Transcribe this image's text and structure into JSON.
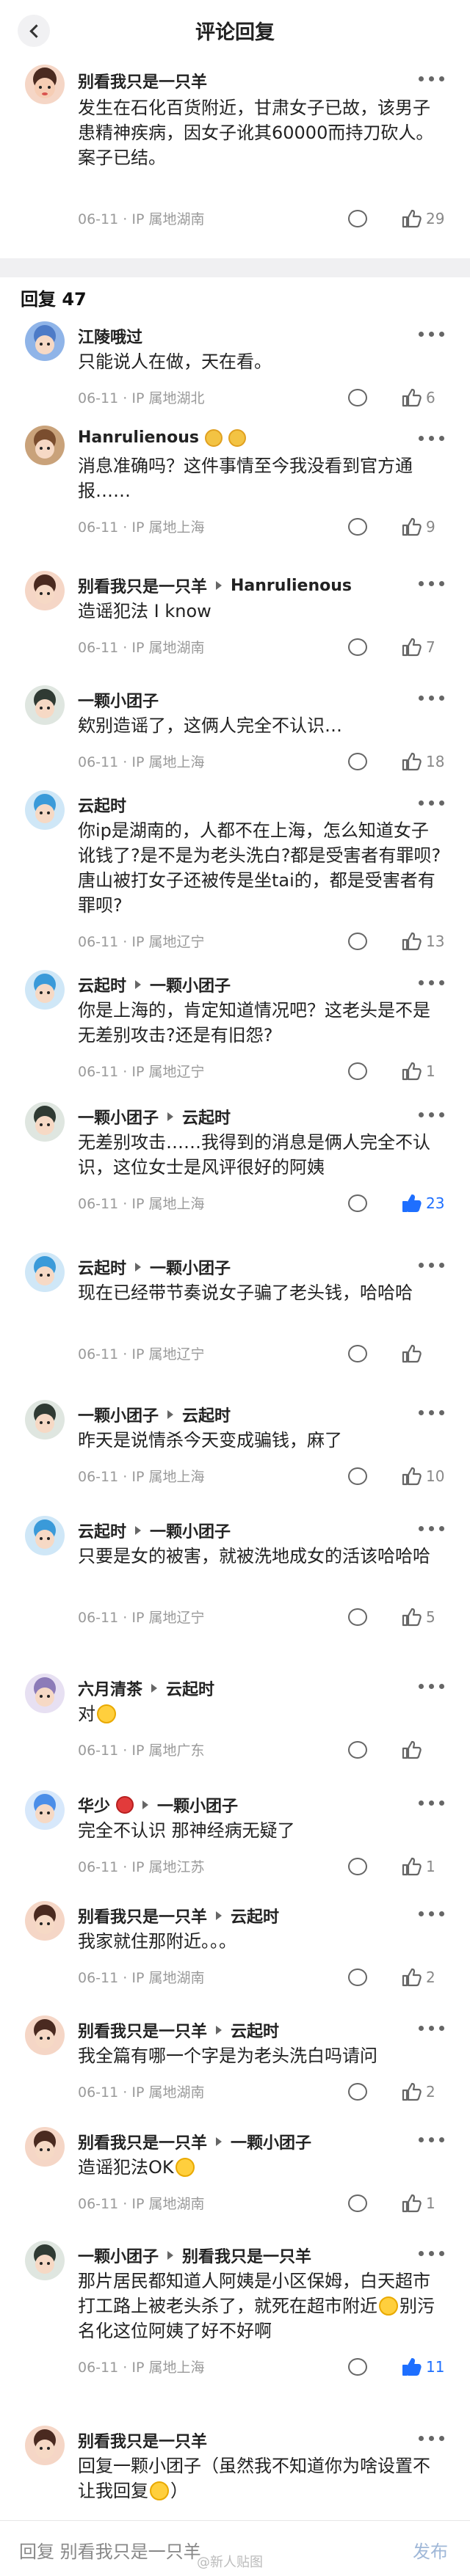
{
  "header": {
    "title": "评论回复"
  },
  "root_comment": {
    "author": "别看我只是一只羊",
    "text": "发生在石化百货附近，甘肃女子已故，该男子患精神疾病，因女子讹其60000而持刀砍人。案子已结。",
    "date": "06-11",
    "location": "IP 属地湖南",
    "likes": "29"
  },
  "replies_header": "回复 47",
  "comments": [
    {
      "author": "江陵哦过",
      "target": "",
      "text": "只能说人在做，天在看。",
      "date": "06-11",
      "location": "IP 属地湖北",
      "likes": "6"
    },
    {
      "author": "Hanrulienous",
      "target": "",
      "text": "消息准确吗？这件事情至今我没看到官方通报……",
      "date": "06-11",
      "location": "IP 属地上海",
      "likes": "9"
    },
    {
      "author": "别看我只是一只羊",
      "target": "Hanrulienous",
      "text": "造谣犯法 I know",
      "date": "06-11",
      "location": "IP 属地湖南",
      "likes": "7"
    },
    {
      "author": "一颗小团子",
      "target": "",
      "text": "欸别造谣了，这俩人完全不认识…",
      "date": "06-11",
      "location": "IP 属地上海",
      "likes": "18"
    },
    {
      "author": "云起时",
      "target": "",
      "text": "你ip是湖南的，人都不在上海，怎么知道女子讹钱了?是不是为老头洗白?都是受害者有罪呗?唐山被打女子还被传是坐tai的，都是受害者有罪呗?",
      "date": "06-11",
      "location": "IP 属地辽宁",
      "likes": "13"
    },
    {
      "author": "云起时",
      "target": "一颗小团子",
      "text": "你是上海的，肯定知道情况吧？这老头是不是无差别攻击?还是有旧怨?",
      "date": "06-11",
      "location": "IP 属地辽宁",
      "likes": "1"
    },
    {
      "author": "一颗小团子",
      "target": "云起时",
      "text": "无差别攻击……我得到的消息是俩人完全不认识，这位女士是风评很好的阿姨",
      "date": "06-11",
      "location": "IP 属地上海",
      "likes": "23"
    },
    {
      "author": "云起时",
      "target": "一颗小团子",
      "text": "现在已经带节奏说女子骗了老头钱，哈哈哈",
      "date": "06-11",
      "location": "IP 属地辽宁",
      "likes": ""
    },
    {
      "author": "一颗小团子",
      "target": "云起时",
      "text": "昨天是说情杀今天变成骗钱，麻了",
      "date": "06-11",
      "location": "IP 属地上海",
      "likes": "10"
    },
    {
      "author": "云起时",
      "target": "一颗小团子",
      "text": "只要是女的被害，就被洗地成女的活该哈哈哈",
      "date": "06-11",
      "location": "IP 属地辽宁",
      "likes": "5"
    },
    {
      "author": "六月清茶",
      "target": "云起时",
      "text": "对",
      "date": "06-11",
      "location": "IP 属地广东",
      "likes": ""
    },
    {
      "author": "华少",
      "target": "一颗小团子",
      "text": "完全不认识 那神经病无疑了",
      "date": "06-11",
      "location": "IP 属地江苏",
      "likes": "1"
    },
    {
      "author": "别看我只是一只羊",
      "target": "云起时",
      "text": "我家就住那附近。。。",
      "date": "06-11",
      "location": "IP 属地湖南",
      "likes": "2"
    },
    {
      "author": "别看我只是一只羊",
      "target": "云起时",
      "text": "我全篇有哪一个字是为老头洗白吗请问",
      "date": "06-11",
      "location": "IP 属地湖南",
      "likes": "2"
    },
    {
      "author": "别看我只是一只羊",
      "target": "一颗小团子",
      "text": "造谣犯法OK",
      "date": "06-11",
      "location": "IP 属地湖南",
      "likes": "1"
    },
    {
      "author": "一颗小团子",
      "target": "别看我只是一只羊",
      "text": "那片居民都知道人阿姨是小区保姆，白天超市打工路上被老头杀了，就死在超市附近",
      "text2": "别污名化这位阿姨了好不好啊",
      "date": "06-11",
      "location": "IP 属地上海",
      "likes": "11"
    },
    {
      "author": "别看我只是一只羊",
      "target": "",
      "text": "回复一颗小团子（虽然我不知道你为啥设置不让我回复",
      "text2": "）",
      "date": "",
      "location": "",
      "likes": ""
    }
  ],
  "bottom_bar": {
    "input_prefix": "回复 别看我只是一只羊",
    "watermark": "@新人贴图",
    "send_label": "发布"
  },
  "colors": {
    "accent": "#1e6fff",
    "meta": "#9a9a9a",
    "band": "#f0f0f2"
  }
}
